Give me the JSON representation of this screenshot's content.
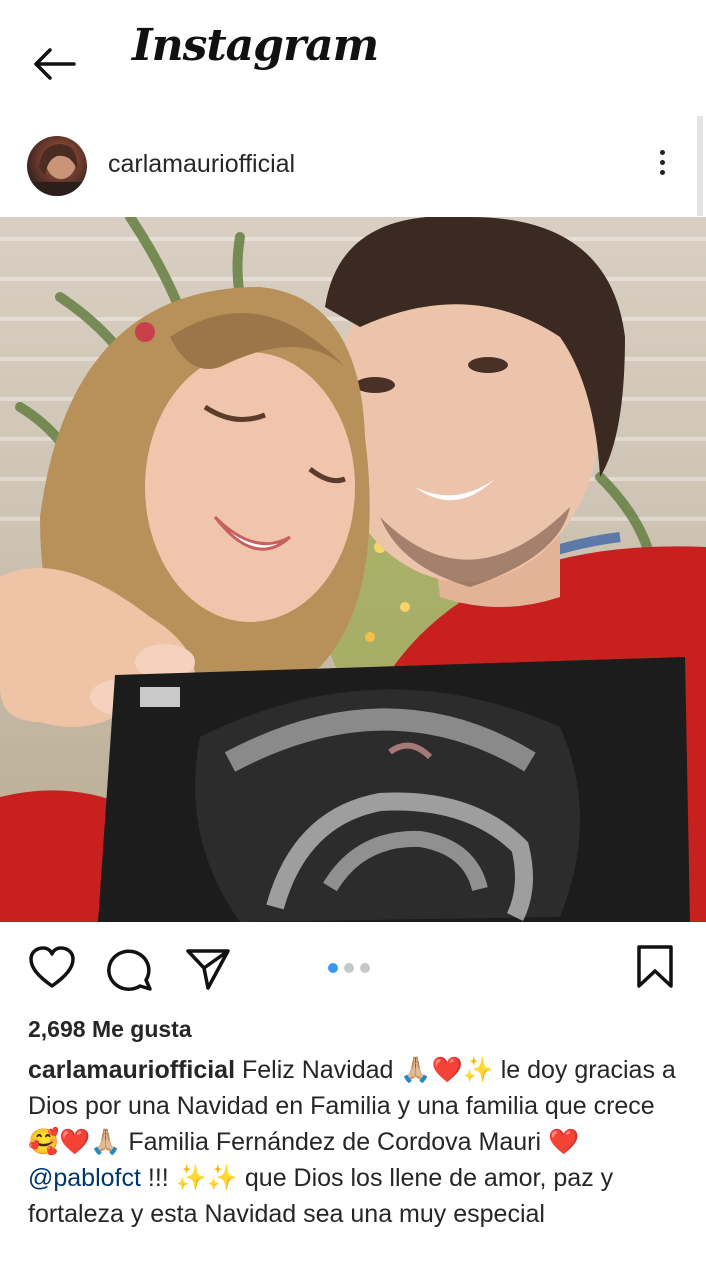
{
  "header": {
    "app_title": "Instagram"
  },
  "post": {
    "username": "carlamauriofficial",
    "likes": "2,698 Me gusta",
    "carousel": {
      "total": 3,
      "active": 1
    },
    "caption": {
      "user": "carlamauriofficial",
      "part1": " Feliz Navidad 🙏🏼❤️✨ le doy gracias a Dios por una Navidad en Familia y una familia que crece 🥰❤️🙏🏼 Familia Fernández de Cordova Mauri ❤️ ",
      "mention": "@pablofct",
      "part2": " !!! ✨✨ que Dios los llene de amor, paz y fortaleza y esta Navidad sea una muy especial"
    }
  },
  "colors": {
    "accent_blue": "#3897f0",
    "text": "#262626",
    "mention": "#00376b"
  },
  "icons": [
    "back-arrow-icon",
    "more-vertical-icon",
    "heart-icon",
    "comment-icon",
    "share-icon",
    "bookmark-icon"
  ]
}
